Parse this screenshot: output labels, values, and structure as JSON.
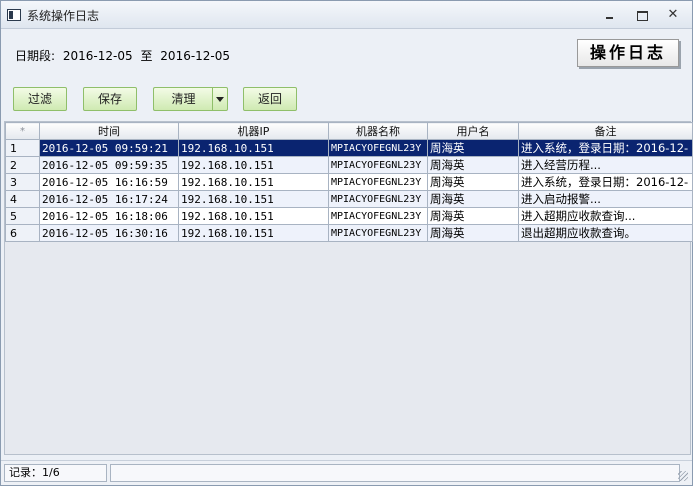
{
  "window": {
    "title": "系统操作日志",
    "controls": [
      "minimize",
      "maximize",
      "close"
    ]
  },
  "header": {
    "date_label": "日期段:",
    "date_from": "2016-12-05",
    "date_sep": "至",
    "date_to": "2016-12-05",
    "badge": "操作日志"
  },
  "toolbar": {
    "filter": "过滤",
    "save": "保存",
    "clean": "清理",
    "back": "返回"
  },
  "table": {
    "corner": "*",
    "columns": [
      "时间",
      "机器IP",
      "机器名称",
      "用户名",
      "备注"
    ],
    "rows": [
      {
        "no": "1",
        "time": "2016-12-05 09:59:21",
        "ip": "192.168.10.151",
        "host": "MPIACYOFEGNL23Y",
        "user": "周海英",
        "note": "进入系统，登录日期：2016-12-"
      },
      {
        "no": "2",
        "time": "2016-12-05 09:59:35",
        "ip": "192.168.10.151",
        "host": "MPIACYOFEGNL23Y",
        "user": "周海英",
        "note": "进入经营历程..."
      },
      {
        "no": "3",
        "time": "2016-12-05 16:16:59",
        "ip": "192.168.10.151",
        "host": "MPIACYOFEGNL23Y",
        "user": "周海英",
        "note": "进入系统，登录日期：2016-12-"
      },
      {
        "no": "4",
        "time": "2016-12-05 16:17:24",
        "ip": "192.168.10.151",
        "host": "MPIACYOFEGNL23Y",
        "user": "周海英",
        "note": "进入启动报警..."
      },
      {
        "no": "5",
        "time": "2016-12-05 16:18:06",
        "ip": "192.168.10.151",
        "host": "MPIACYOFEGNL23Y",
        "user": "周海英",
        "note": "进入超期应收款查询..."
      },
      {
        "no": "6",
        "time": "2016-12-05 16:30:16",
        "ip": "192.168.10.151",
        "host": "MPIACYOFEGNL23Y",
        "user": "周海英",
        "note": "退出超期应收款查询。"
      }
    ]
  },
  "status": {
    "record": "记录：1/6",
    "message": ""
  },
  "colors": {
    "selection": "#0a2470",
    "button_fill": "#cfeab2",
    "alt_row": "#eef2fb"
  }
}
